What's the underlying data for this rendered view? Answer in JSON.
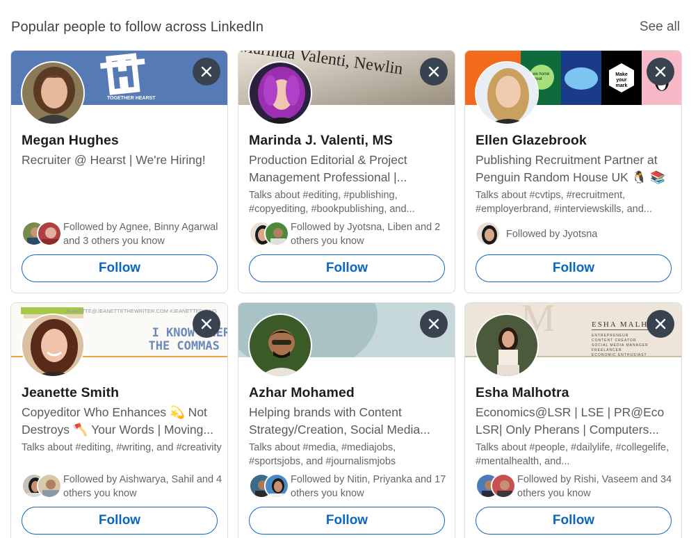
{
  "header": {
    "title": "Popular people to follow across LinkedIn",
    "see_all": "See all"
  },
  "follow_label": "Follow",
  "colors": {
    "accent": "#0a66c2",
    "dismiss_bg": "#38434f"
  },
  "cards": [
    {
      "name": "Megan Hughes",
      "headline": "Recruiter @ Hearst | We're Hiring!",
      "talks": "",
      "followed": "Followed by Agnee, Binny Agarwal and 3 others you know",
      "banner_text": "TOGETHER HEARST"
    },
    {
      "name": "Marinda J. Valenti, MS",
      "headline": "Production Editorial & Project Management Professional |...",
      "talks": "Talks about #editing, #publishing, #copyediting, #bookpublishing, and...",
      "followed": "Followed by Jyotsna, Liben and 2 others you know",
      "banner_text": "Marinda Valenti, Newlin"
    },
    {
      "name": "Ellen Glazebrook",
      "headline": "Publishing Recruitment Partner at Penguin Random House UK 🐧 📚",
      "talks": "Talks about #cvtips, #recruitment, #employerbrand, #interviewskills, and...",
      "followed": "Followed by Jyotsna",
      "banner_text": "Make your mark"
    },
    {
      "name": "Jeanette Smith",
      "headline": "Copyeditor Who Enhances 💫 Not Destroys 🪓 Your Words | Moving...",
      "talks": "Talks about #editing, #writing, and #creativity",
      "followed": "Followed by Aishwarya, Sahil and 4 others you know",
      "banner_text": "I KNOW WHERE THE COMMAS GO",
      "banner_small": "JEANETTE@JEANETTETHEWRITER.COM #JEANETTEDITING"
    },
    {
      "name": "Azhar Mohamed",
      "headline": "Helping brands with Content Strategy/Creation, Social Media...",
      "talks": "Talks about #media, #mediajobs, #sportsjobs, and #journalismjobs",
      "followed": "Followed by Nitin, Priyanka and 17 others you know",
      "banner_text": ""
    },
    {
      "name": "Esha Malhotra",
      "headline": "Economics@LSR | LSE | PR@Eco LSR| Only Pherans | Computers...",
      "talks": "Talks about #people, #dailylife, #collegelife, #mentalhealth, and...",
      "followed": "Followed by Rishi, Vaseem and 34 others you know",
      "banner_text": "ESHA MALHOTRA",
      "banner_small": "ENTREPRENEUR CONTENT CREATOR SOCIAL MEDIA MANAGER FREELANCER ECONOMIC ENTHUSIAST"
    }
  ]
}
